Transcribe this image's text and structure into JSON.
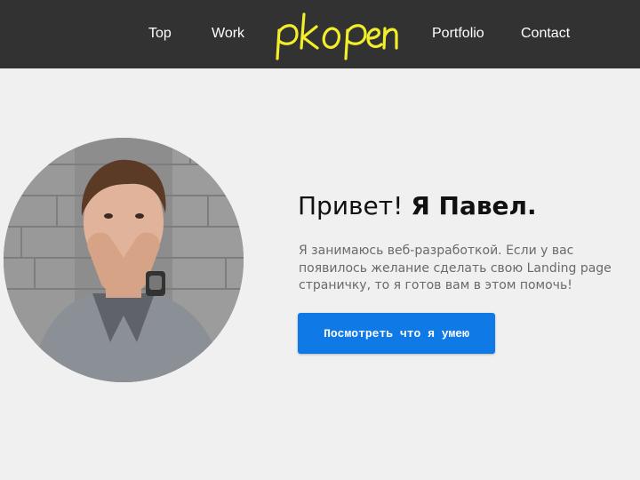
{
  "nav": {
    "items": [
      {
        "label": "Top"
      },
      {
        "label": "Work"
      },
      {
        "label": "Portfolio"
      },
      {
        "label": "Contact"
      }
    ],
    "logo_text": "pkopen"
  },
  "hero": {
    "greeting": "Привет!",
    "name": "Я Павел.",
    "description": "Я занимаюсь веб-разработкой. Если у вас появилось желание сделать свою Landing page страничку, то я готов вам в этом помочь!",
    "button_label": "Посмотреть что я умею"
  },
  "colors": {
    "nav_background": "#323232",
    "logo": "#f2ee2a",
    "page_background": "#f0f0f0",
    "button": "#0f7ae6",
    "text_muted": "#6a6a6a"
  }
}
